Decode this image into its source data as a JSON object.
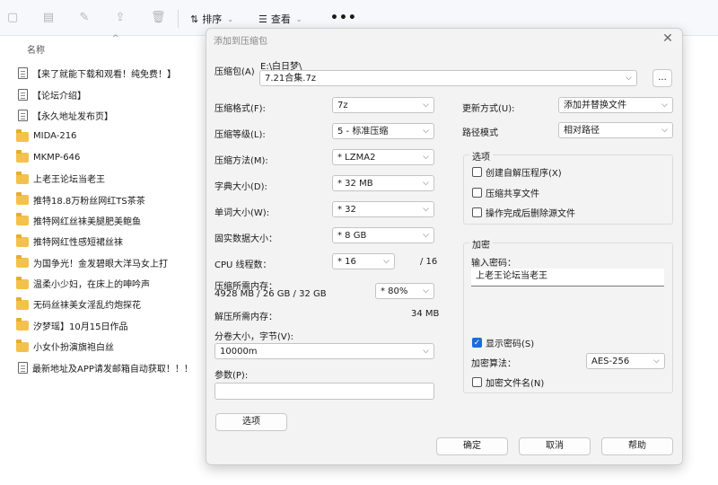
{
  "toolbar": {
    "sort_label": "排序",
    "view_label": "查看",
    "more_label": "•••"
  },
  "file_list": {
    "column_name": "名称",
    "items": [
      {
        "type": "doc",
        "name": "【来了就能下载和观看！纯免费！】"
      },
      {
        "type": "doc",
        "name": "【论坛介绍】"
      },
      {
        "type": "doc",
        "name": "【永久地址发布页】"
      },
      {
        "type": "folder",
        "name": "MIDA-216"
      },
      {
        "type": "folder",
        "name": "MKMP-646"
      },
      {
        "type": "folder",
        "name": "上老王论坛当老王"
      },
      {
        "type": "folder",
        "name": "推特18.8万粉丝网红TS茶茶"
      },
      {
        "type": "folder",
        "name": "推特网红丝袜美腿肥美鲍鱼"
      },
      {
        "type": "folder",
        "name": "推特网红性感短裙丝袜"
      },
      {
        "type": "folder",
        "name": "为国争光！金发碧眼大洋马女上打"
      },
      {
        "type": "folder",
        "name": "温柔小少妇，在床上的呻吟声"
      },
      {
        "type": "folder",
        "name": "无码丝袜美女淫乱约炮探花"
      },
      {
        "type": "folder",
        "name": "汐梦瑶】10月15日作品"
      },
      {
        "type": "folder",
        "name": "小女仆扮演旗袍白丝"
      },
      {
        "type": "doc",
        "name": "最新地址及APP请发邮箱自动获取！！！"
      }
    ]
  },
  "dialog": {
    "title": "添加到压缩包",
    "archive_label": "压缩包(A)",
    "archive_dir": "E:\\白日梦\\",
    "archive_name": "7.21合集.7z",
    "browse_label": "...",
    "format_label": "压缩格式(F):",
    "format_value": "7z",
    "level_label": "压缩等级(L):",
    "level_value": "5 - 标准压缩",
    "method_label": "压缩方法(M):",
    "method_value": "* LZMA2",
    "dict_label": "字典大小(D):",
    "dict_value": "* 32 MB",
    "word_label": "单词大小(W):",
    "word_value": "* 32",
    "solid_label": "固实数据大小：",
    "solid_value": "* 8 GB",
    "threads_label": "CPU 线程数：",
    "threads_value": "* 16",
    "threads_max": "/ 16",
    "mem_compress_label": "压缩所需内存：",
    "mem_compress_detail": "4928 MB / 26 GB / 32 GB",
    "mem_percent_value": "* 80%",
    "mem_decompress_label": "解压所需内存：",
    "mem_decompress_value": "34 MB",
    "volume_label": "分卷大小，字节(V):",
    "volume_value": "10000m",
    "params_label": "参数(P):",
    "params_value": "",
    "options_button": "选项",
    "update_label": "更新方式(U):",
    "update_value": "添加并替换文件",
    "path_label": "路径模式",
    "path_value": "相对路径",
    "options_group": {
      "title": "选项",
      "sfx": {
        "label": "创建自解压程序(X)",
        "checked": false
      },
      "shared": {
        "label": "压缩共享文件",
        "checked": false
      },
      "delete": {
        "label": "操作完成后删除源文件",
        "checked": false
      }
    },
    "encryption_group": {
      "title": "加密",
      "password_label": "输入密码：",
      "password_value": "上老王论坛当老王",
      "show_password": {
        "label": "显示密码(S)",
        "checked": true
      },
      "method_label": "加密算法：",
      "method_value": "AES-256",
      "encrypt_names": {
        "label": "加密文件名(N)",
        "checked": false
      }
    },
    "ok_button": "确定",
    "cancel_button": "取消",
    "help_button": "帮助"
  }
}
